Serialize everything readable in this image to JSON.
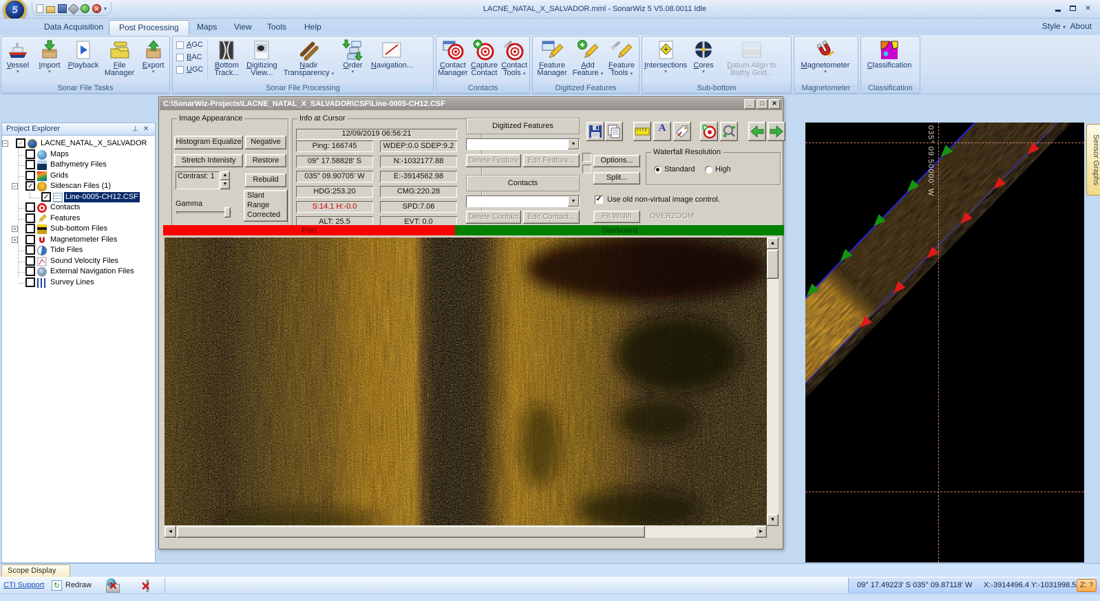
{
  "titlebar": {
    "title": "LACNE_NATAL_X_SALVADOR.mml - SonarWiz 5 V5.08.0011 Idle"
  },
  "tabs": {
    "items": [
      "Data Acquisition",
      "Post Processing",
      "Maps",
      "View",
      "Tools",
      "Help"
    ],
    "style_label": "Style",
    "about_label": "About"
  },
  "ribbon": {
    "groups": [
      {
        "label": "Sonar File Tasks",
        "items": [
          {
            "label": "Vessel"
          },
          {
            "label": "Import"
          },
          {
            "label": "Playback"
          },
          {
            "label": "File Manager"
          },
          {
            "label": "Export"
          }
        ]
      },
      {
        "label": "Sonar File Processing",
        "checks": [
          "AGC",
          "BAC",
          "UGC"
        ],
        "items": [
          {
            "label": "Bottom Track..."
          },
          {
            "label": "Digitizing View..."
          },
          {
            "label": "Nadir Transparency"
          },
          {
            "label": "Order"
          },
          {
            "label": "Navigation..."
          }
        ]
      },
      {
        "label": "Contacts",
        "items": [
          {
            "label": "Contact Manager"
          },
          {
            "label": "Capture Contact"
          },
          {
            "label": "Contact Tools"
          }
        ]
      },
      {
        "label": "Digitized Features",
        "items": [
          {
            "label": "Feature Manager"
          },
          {
            "label": "Add Feature"
          },
          {
            "label": "Feature Tools"
          }
        ]
      },
      {
        "label": "Sub-bottom",
        "items": [
          {
            "label": "Intersections"
          },
          {
            "label": "Cores"
          },
          {
            "label": "Datum Align to Bathy Grid..."
          }
        ]
      },
      {
        "label": "Magnetometer",
        "items": [
          {
            "label": "Magnetometer"
          }
        ]
      },
      {
        "label": "Classification",
        "items": [
          {
            "label": "Classification"
          }
        ]
      }
    ]
  },
  "explorer": {
    "header": "Project Explorer",
    "items": [
      {
        "label": "LACNE_NATAL_X_SALVADOR",
        "checked": "gray",
        "expand": "minus"
      },
      {
        "label": "Maps",
        "checked": "no"
      },
      {
        "label": "Bathymetry Files",
        "checked": "no"
      },
      {
        "label": "Grids",
        "checked": "no"
      },
      {
        "label": "Sidescan Files (1)",
        "checked": "yes",
        "expand": "minus"
      },
      {
        "label": "Line-0005-CH12.CSF",
        "checked": "yes",
        "selected": true
      },
      {
        "label": "Contacts",
        "checked": "no"
      },
      {
        "label": "Features",
        "checked": "no"
      },
      {
        "label": "Sub-bottom Files",
        "checked": "no",
        "expand": "plus"
      },
      {
        "label": "Magnetometer Files",
        "checked": "no",
        "expand": "plus"
      },
      {
        "label": "Tide Files",
        "checked": "no"
      },
      {
        "label": "Sound Velocity Files",
        "checked": "no"
      },
      {
        "label": "External Navigation Files",
        "checked": "no"
      },
      {
        "label": "Survey Lines",
        "checked": "no"
      }
    ]
  },
  "doc": {
    "title": "C:\\SonarWiz-Projects\\LACNE_NATAL_X_SALVADOR\\CSF\\Line-0005-CH12.CSF",
    "image_appearance": {
      "title": "Image Appearance",
      "hist": "Histogram Equalize",
      "neg": "Negative",
      "stretch": "Stretch Intenisty",
      "restore": "Restore",
      "contrast": "Contrast: 1",
      "rebuild": "Rebuild",
      "gamma": "Gamma",
      "slant": "Slant Range Corrected"
    },
    "info": {
      "title": "Info at Cursor",
      "datetime": "12/09/2019 06:56:21",
      "left": [
        "Ping: 166745",
        "09° 17.58828' S",
        "035° 09.90705' W",
        "HDG:253.20",
        "S:14.1 H:-0.0",
        "ALT: 25.5"
      ],
      "right": [
        "WDEP:0.0 SDEP:9.2",
        "N:-1032177.88",
        "E:-3914562.98",
        "CMG:220.28",
        "SPD:7.06",
        "EVT: 0.0"
      ]
    },
    "features": {
      "title": "Digitized Features",
      "del": "Delete Feature",
      "edit": "Edit Feature..."
    },
    "contacts": {
      "title": "Contacts",
      "del": "Delete Contact",
      "edit": "Edit Contact..."
    },
    "controls": {
      "options": "Options...",
      "split": "Split...",
      "wres": "Waterfall Resolution",
      "standard": "Standard",
      "high": "High",
      "oldctl": "Use old non-virtual image control.",
      "fit": "Fit Width",
      "overzoom": "OVERZOOM"
    },
    "port": "Port",
    "starboard": "Starboard"
  },
  "map": {
    "coord_label": "035° 09.50000' W",
    "sensor_tab": "Sensor Graphs"
  },
  "statusbar": {
    "tab": "Scope Display",
    "cti": "CTI Support",
    "redraw": "Redraw",
    "coords": "09° 17.49223' S  035° 09.87118' W",
    "xy": "X:-3914496.4 Y:-1031998.5",
    "z": "Z: ?"
  }
}
